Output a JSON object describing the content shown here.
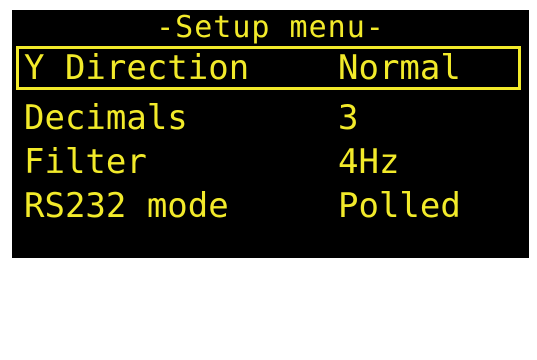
{
  "menu": {
    "title": "-Setup menu-",
    "items": [
      {
        "label": "Y Direction",
        "value": "Normal",
        "selected": true
      },
      {
        "label": "Decimals",
        "value": "3",
        "selected": false
      },
      {
        "label": "Filter",
        "value": "4Hz",
        "selected": false
      },
      {
        "label": "RS232 mode",
        "value": "Polled",
        "selected": false
      }
    ]
  },
  "colors": {
    "background": "#000000",
    "foreground": "#f2ea2a"
  }
}
